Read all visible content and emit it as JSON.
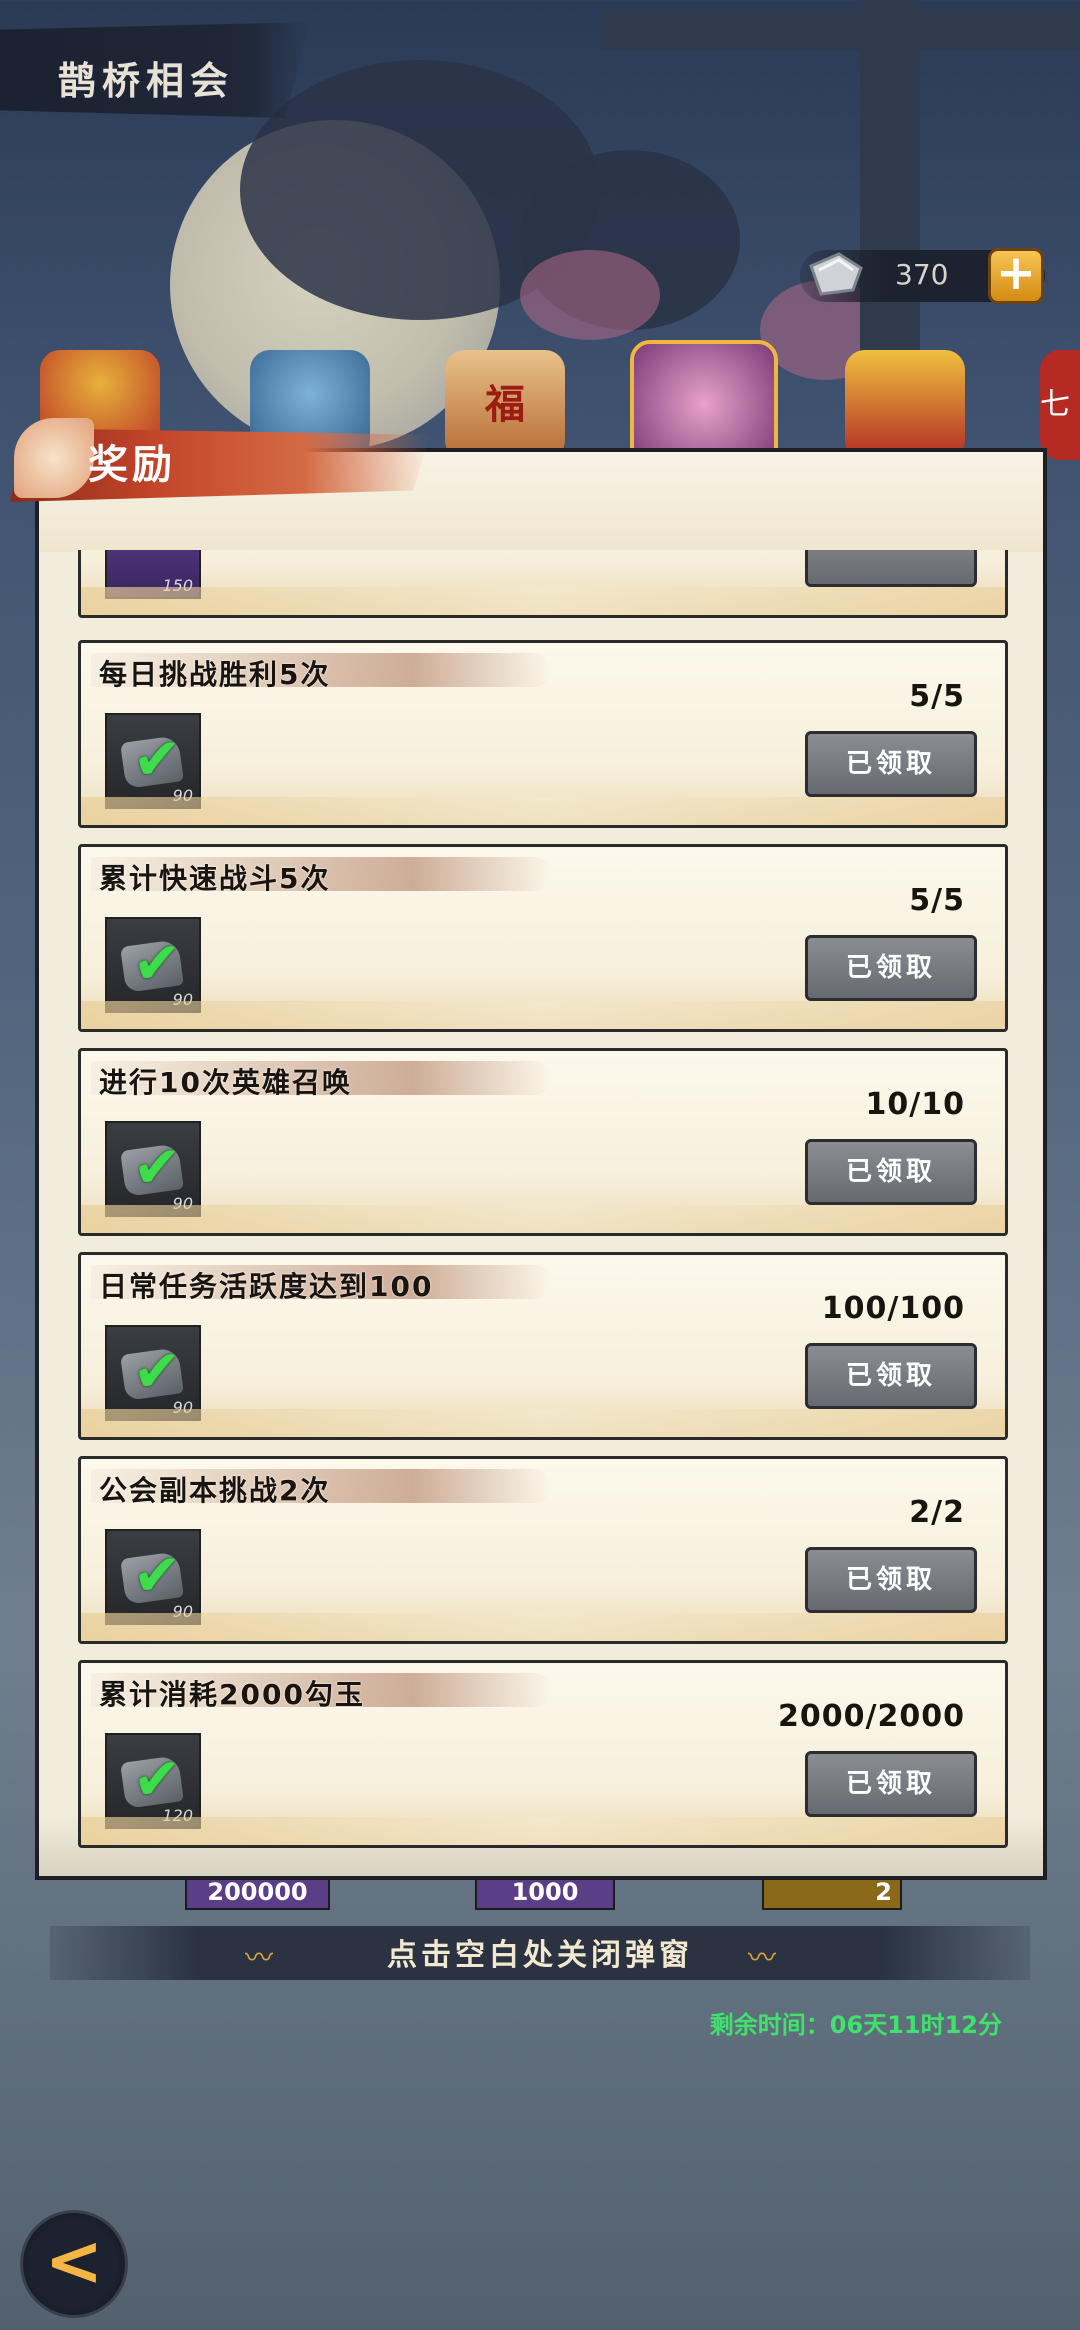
{
  "header": {
    "title": "鹊桥相会"
  },
  "currency": {
    "value": "370",
    "add_label": "+"
  },
  "reward_modal": {
    "title": "奖励",
    "partial_item_count": "150",
    "tasks": [
      {
        "name": "每日挑战胜利5次",
        "progress": "5/5",
        "reward_count": "90",
        "button": "已领取"
      },
      {
        "name": "累计快速战斗5次",
        "progress": "5/5",
        "reward_count": "90",
        "button": "已领取"
      },
      {
        "name": "进行10次英雄召唤",
        "progress": "10/10",
        "reward_count": "90",
        "button": "已领取"
      },
      {
        "name": "日常任务活跃度达到100",
        "progress": "100/100",
        "reward_count": "90",
        "button": "已领取"
      },
      {
        "name": "公会副本挑战2次",
        "progress": "2/2",
        "reward_count": "90",
        "button": "已领取"
      },
      {
        "name": "累计消耗2000勾玉",
        "progress": "2000/2000",
        "reward_count": "120",
        "button": "已领取"
      }
    ]
  },
  "behind_modal": {
    "prizes": [
      "200000",
      "1000",
      "2"
    ],
    "top_icon_glyph": "福",
    "side_glyph": "七"
  },
  "close_hint": "点击空白处关闭弹窗",
  "remaining_time": "剩余时间：06天11时12分",
  "back_icon": "<"
}
